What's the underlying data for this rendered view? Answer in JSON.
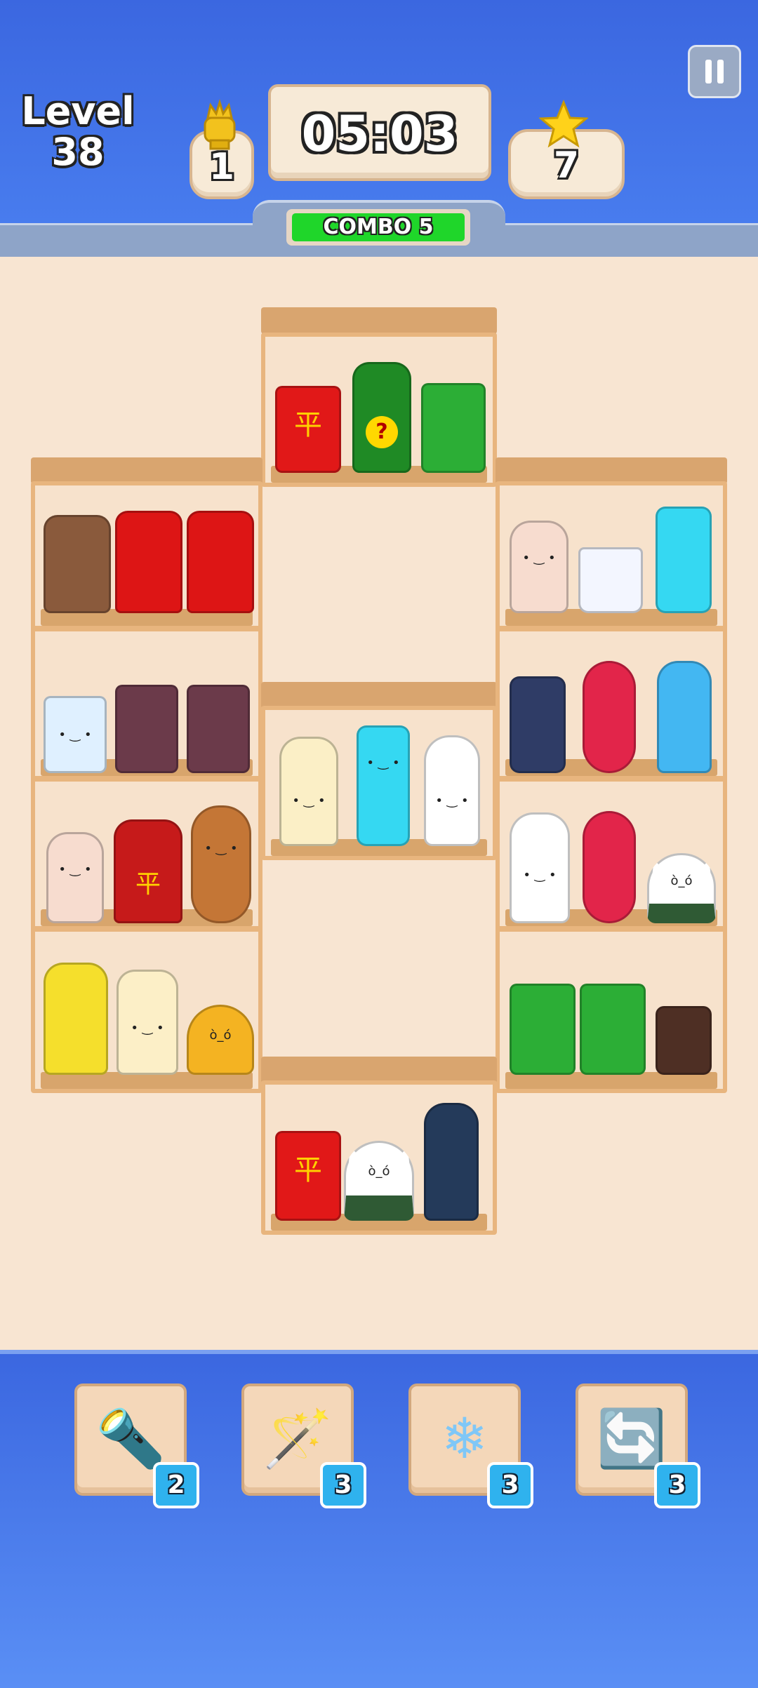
{
  "header": {
    "level_label": "Level",
    "level_value": "38",
    "trophy_count": "1",
    "timer": "05:03",
    "star_count": "7",
    "combo_text": "COMBO 5"
  },
  "icons": {
    "trophy": "trophy-icon",
    "star": "star-icon",
    "pause": "pause-icon"
  },
  "shelves": [
    {
      "id": "top-center",
      "items": [
        "red-snack-bag",
        "green-mystery-bottle",
        "green-pretzel-box"
      ]
    },
    {
      "id": "left-1",
      "items": [
        "coffee-cup",
        "red-can",
        "red-can"
      ]
    },
    {
      "id": "left-2",
      "items": [
        "milk-carton",
        "strawberry-box",
        "strawberry-box"
      ]
    },
    {
      "id": "left-3",
      "items": [
        "yogurt-bottle",
        "red-snack-bag",
        "corndog"
      ]
    },
    {
      "id": "left-4",
      "items": [
        "juice-bottle",
        "milk-bottle",
        "onigiri"
      ]
    },
    {
      "id": "center-middle",
      "items": [
        "milk-bottle",
        "ice-pop",
        "mayo-bottle"
      ]
    },
    {
      "id": "right-1",
      "items": [
        "yogurt-bottle",
        "noodle-cup",
        "ice-pop"
      ]
    },
    {
      "id": "right-2",
      "items": [
        "energy-can",
        "candied-fruit-skewer",
        "water-bottle"
      ]
    },
    {
      "id": "right-3",
      "items": [
        "mayo-bottle",
        "candied-fruit-skewer",
        "onigiri"
      ]
    },
    {
      "id": "right-4",
      "items": [
        "green-pretzel-box",
        "green-pretzel-box",
        "brown-can"
      ]
    },
    {
      "id": "bottom-center",
      "items": [
        "red-snack-bag",
        "onigiri",
        "water-bottle"
      ]
    }
  ],
  "boosters": [
    {
      "name": "scanner-icon",
      "count": "2",
      "symbol": "🔦"
    },
    {
      "name": "magic-wand-icon",
      "count": "3",
      "symbol": "🪄"
    },
    {
      "name": "snowflake-icon",
      "count": "3",
      "symbol": "❄"
    },
    {
      "name": "shuffle-icon",
      "count": "3",
      "symbol": "🔄"
    }
  ],
  "colors": {
    "background_blue": "#3f6fe6",
    "board": "#f8e5d2",
    "shelf_wood": "#e8b57e",
    "combo_green": "#1fd62a",
    "badge_blue": "#2fb2ee"
  }
}
